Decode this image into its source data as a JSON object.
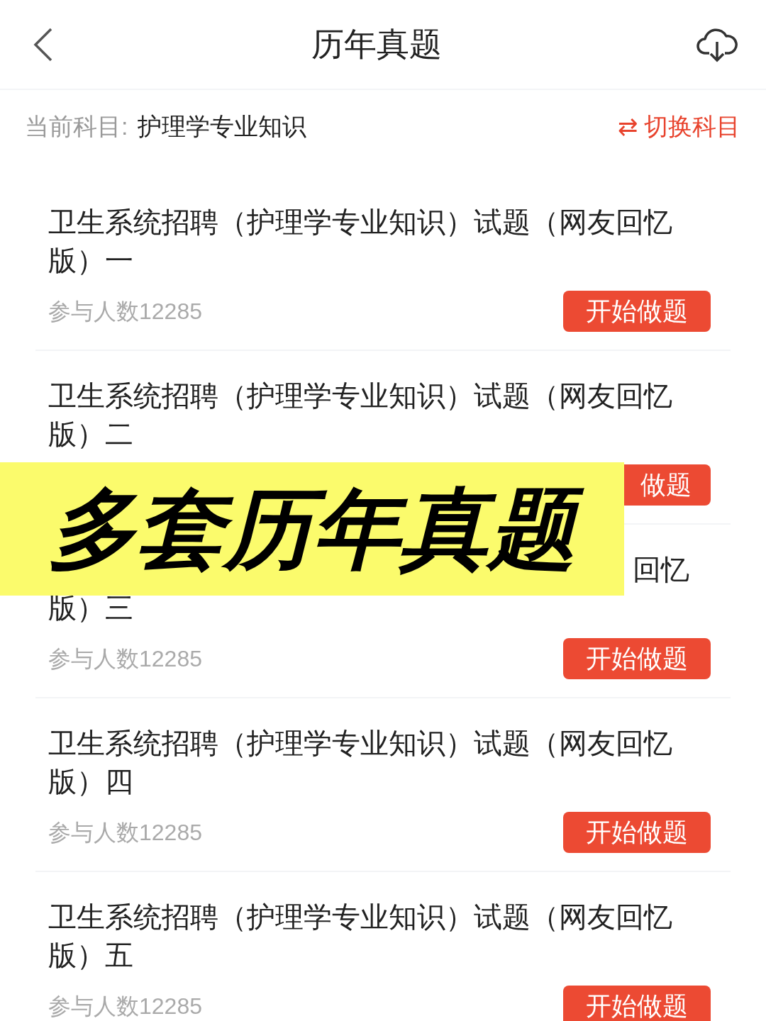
{
  "header": {
    "title": "历年真题"
  },
  "subject": {
    "label": "当前科目:",
    "value": "护理学专业知识",
    "switch": "⇄ 切换科目"
  },
  "items": [
    {
      "kind": "full",
      "title_lines": [
        "卫生系统招聘（护理学专业知识）试题（网友回忆",
        "版）一"
      ],
      "count": "参与人数12285",
      "button": "开始做题"
    },
    {
      "kind": "full",
      "title_lines": [
        "卫生系统招聘（护理学专业知识）试题（网友回忆",
        "版）二"
      ],
      "button": "做题"
    },
    {
      "kind": "covered",
      "title_lines": [
        "回忆",
        "版）三"
      ],
      "count": "参与人数12285",
      "button": "开始做题"
    },
    {
      "kind": "full",
      "title_lines": [
        "卫生系统招聘（护理学专业知识）试题（网友回忆",
        "版）四"
      ],
      "count": "参与人数12285",
      "button": "开始做题"
    },
    {
      "kind": "full",
      "title_lines": [
        "卫生系统招聘（护理学专业知识）试题（网友回忆",
        "版）五"
      ],
      "count": "参与人数12285",
      "button": "开始做题"
    }
  ],
  "banner": {
    "text": "多套历年真题"
  }
}
